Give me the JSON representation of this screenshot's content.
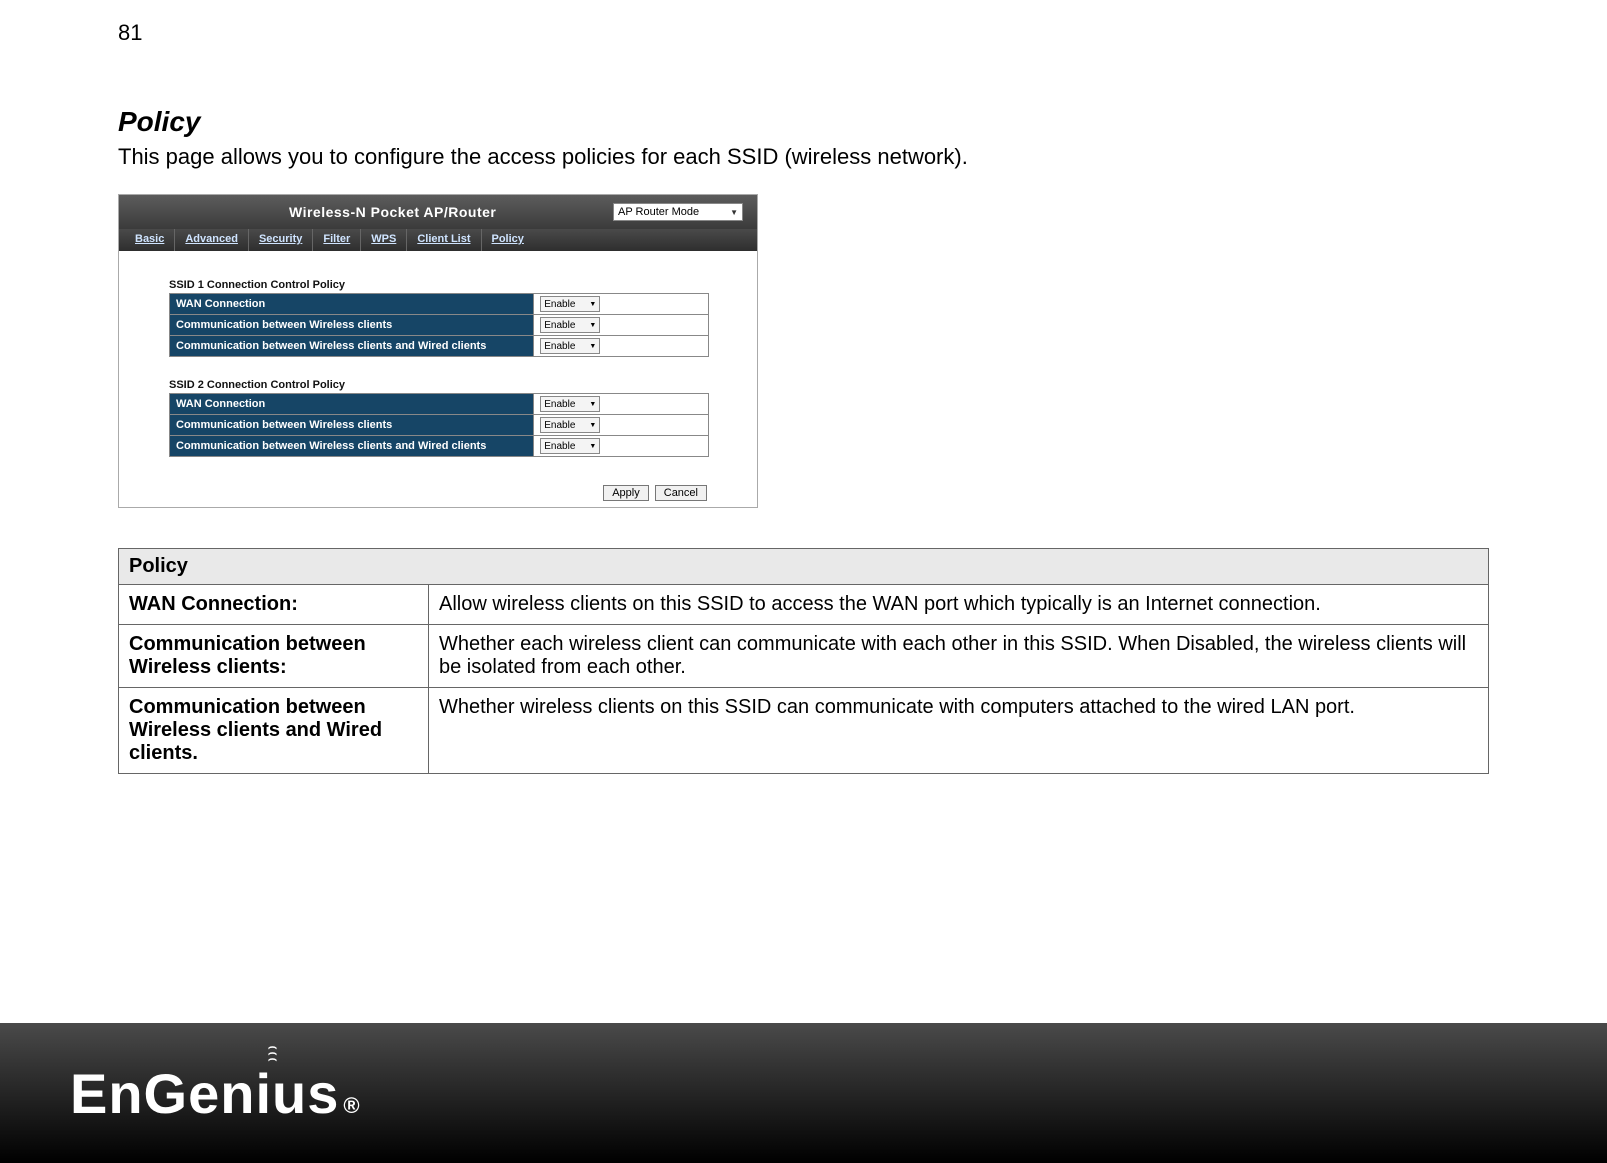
{
  "page_number": "81",
  "section": {
    "title": "Policy",
    "description": "This page allows you to configure the access policies for each SSID (wireless network)."
  },
  "screenshot": {
    "header_title": "Wireless-N Pocket AP/Router",
    "mode_selected": "AP Router Mode",
    "tabs": [
      "Basic",
      "Advanced",
      "Security",
      "Filter",
      "WPS",
      "Client List",
      "Policy"
    ],
    "groups": [
      {
        "title": "SSID 1 Connection Control Policy",
        "rows": [
          {
            "label": "WAN Connection",
            "value": "Enable"
          },
          {
            "label": "Communication between Wireless clients",
            "value": "Enable"
          },
          {
            "label": "Communication between Wireless clients and Wired clients",
            "value": "Enable"
          }
        ]
      },
      {
        "title": "SSID 2 Connection Control Policy",
        "rows": [
          {
            "label": "WAN Connection",
            "value": "Enable"
          },
          {
            "label": "Communication between Wireless clients",
            "value": "Enable"
          },
          {
            "label": "Communication between Wireless clients and Wired clients",
            "value": "Enable"
          }
        ]
      }
    ],
    "buttons": {
      "apply": "Apply",
      "cancel": "Cancel"
    }
  },
  "desc_table": {
    "header": "Policy",
    "rows": [
      {
        "key": "WAN Connection:",
        "val": "Allow wireless clients on this SSID to access the WAN port which typically is an Internet connection."
      },
      {
        "key": "Communication between Wireless clients:",
        "val": "Whether each wireless client can communicate with each other in this SSID. When Disabled, the wireless clients will be isolated from each other."
      },
      {
        "key": "Communication between Wireless clients and Wired clients.",
        "val": "Whether wireless clients on this SSID can communicate with computers attached to the wired LAN port."
      }
    ]
  },
  "footer": {
    "brand": "EnGenius",
    "reg": "®"
  }
}
